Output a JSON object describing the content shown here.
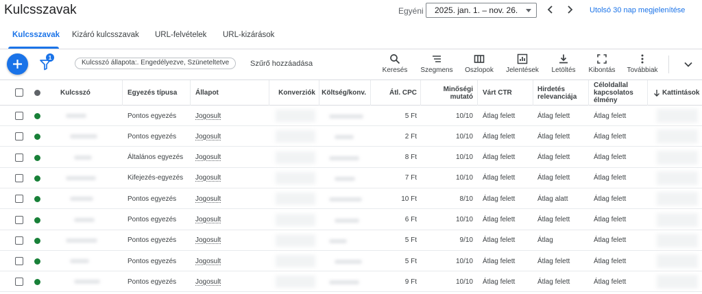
{
  "header": {
    "title": "Kulcsszavak",
    "date_label": "Egyéni",
    "date_range": "2025. jan. 1. – nov. 26.",
    "last_30_label": "Utolsó 30 nap megjelenítése"
  },
  "tabs": [
    {
      "label": "Kulcsszavak",
      "active": true
    },
    {
      "label": "Kizáró kulcsszavak",
      "active": false
    },
    {
      "label": "URL-felvételek",
      "active": false
    },
    {
      "label": "URL-kizárások",
      "active": false
    }
  ],
  "toolbar": {
    "filter_count": "1",
    "filter_chip": "Kulcsszó állapota:. Engedélyezve, Szüneteltetve",
    "add_filter": "Szűrő hozzáadása",
    "tools": [
      {
        "label": "Keresés",
        "icon": "search-icon"
      },
      {
        "label": "Szegmens",
        "icon": "segment-icon"
      },
      {
        "label": "Oszlopok",
        "icon": "columns-icon"
      },
      {
        "label": "Jelentések",
        "icon": "reports-icon"
      },
      {
        "label": "Letöltés",
        "icon": "download-icon"
      },
      {
        "label": "Kibontás",
        "icon": "expand-icon"
      },
      {
        "label": "Továbbiak",
        "icon": "more-vert-icon"
      }
    ]
  },
  "colors": {
    "accent": "#1a73e8",
    "status_green": "#188038",
    "header_dot": "#5f6368"
  },
  "table": {
    "columns": {
      "keyword": "Kulcsszó",
      "match_type": "Egyezés típusa",
      "status": "Állapot",
      "conversions": "Konverziók",
      "cost_per_conv": "Költség/konv.",
      "avg_cpc": "Átl. CPC",
      "quality_score": "Minőségi mutató",
      "expected_ctr": "Várt CTR",
      "ad_relevance": "Hirdetés relevanciája",
      "landing_page": "Céloldallal kapcsolatos élmény",
      "clicks": "Kattintások"
    },
    "rows": [
      {
        "match": "Pontos egyezés",
        "status": "Jogosult",
        "cpc": "5 Ft",
        "qs": "10/10",
        "ctr": "Átlag felett",
        "rel": "Átlag felett",
        "lp": "Átlag felett"
      },
      {
        "match": "Pontos egyezés",
        "status": "Jogosult",
        "cpc": "2 Ft",
        "qs": "10/10",
        "ctr": "Átlag felett",
        "rel": "Átlag felett",
        "lp": "Átlag felett"
      },
      {
        "match": "Általános egyezés",
        "status": "Jogosult",
        "cpc": "8 Ft",
        "qs": "10/10",
        "ctr": "Átlag felett",
        "rel": "Átlag felett",
        "lp": "Átlag felett"
      },
      {
        "match": "Kifejezés-egyezés",
        "status": "Jogosult",
        "cpc": "7 Ft",
        "qs": "10/10",
        "ctr": "Átlag felett",
        "rel": "Átlag felett",
        "lp": "Átlag felett"
      },
      {
        "match": "Pontos egyezés",
        "status": "Jogosult",
        "cpc": "10 Ft",
        "qs": "8/10",
        "ctr": "Átlag felett",
        "rel": "Átlag alatt",
        "lp": "Átlag felett"
      },
      {
        "match": "Pontos egyezés",
        "status": "Jogosult",
        "cpc": "6 Ft",
        "qs": "10/10",
        "ctr": "Átlag felett",
        "rel": "Átlag felett",
        "lp": "Átlag felett"
      },
      {
        "match": "Pontos egyezés",
        "status": "Jogosult",
        "cpc": "5 Ft",
        "qs": "9/10",
        "ctr": "Átlag felett",
        "rel": "Átlag",
        "lp": "Átlag felett"
      },
      {
        "match": "Pontos egyezés",
        "status": "Jogosult",
        "cpc": "5 Ft",
        "qs": "10/10",
        "ctr": "Átlag felett",
        "rel": "Átlag felett",
        "lp": "Átlag felett"
      },
      {
        "match": "Pontos egyezés",
        "status": "Jogosult",
        "cpc": "9 Ft",
        "qs": "10/10",
        "ctr": "Átlag felett",
        "rel": "Átlag felett",
        "lp": "Átlag felett"
      }
    ]
  }
}
